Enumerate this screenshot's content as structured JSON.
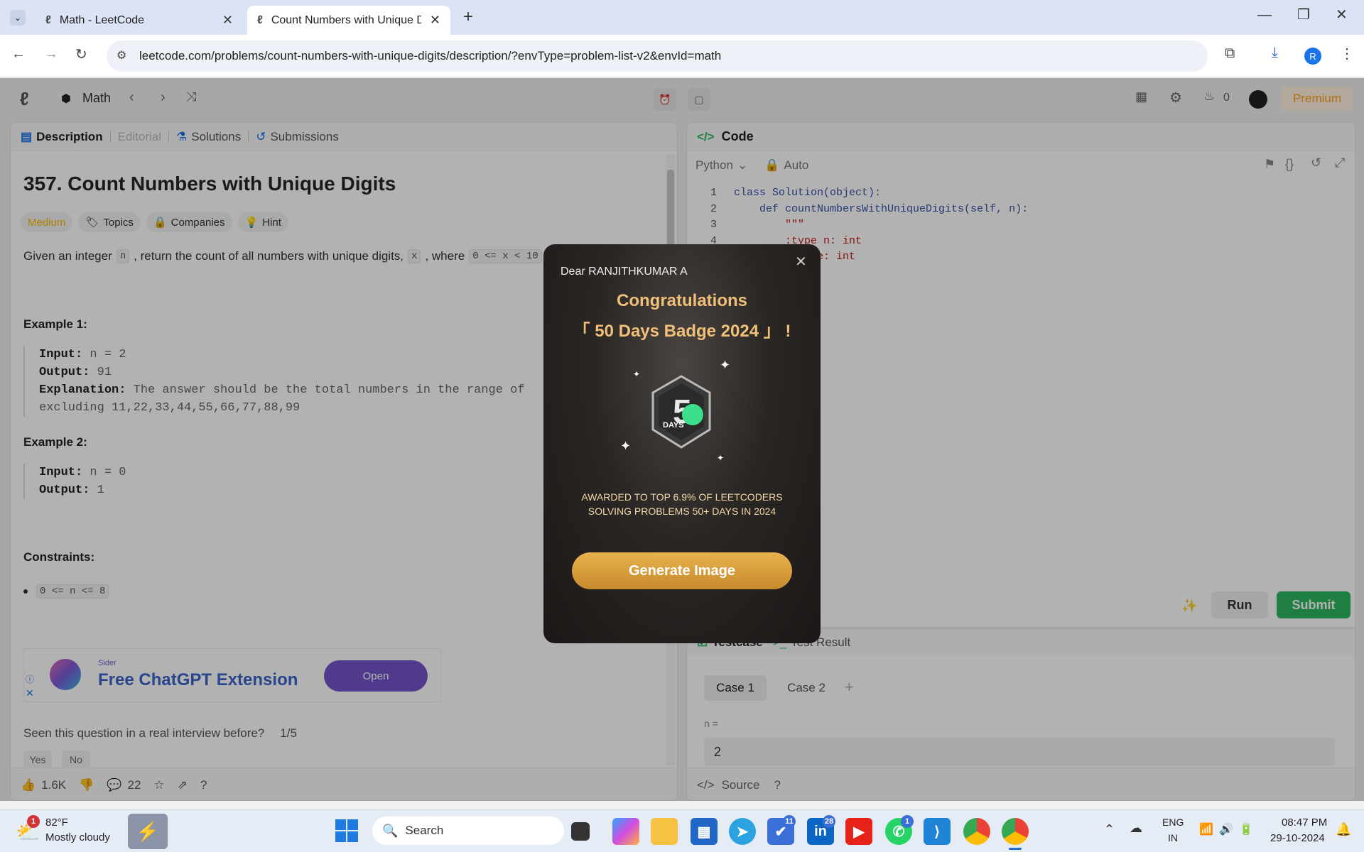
{
  "browser": {
    "tabs": [
      {
        "title": "Math - LeetCode"
      },
      {
        "title": "Count Numbers with Unique Di"
      }
    ],
    "url": "leetcode.com/problems/count-numbers-with-unique-digits/description/?envType=problem-list-v2&envId=math",
    "profile_initial": "R"
  },
  "nav": {
    "list_name": "Math",
    "streak": "0",
    "premium": "Premium"
  },
  "left": {
    "tabs": [
      "Description",
      "Editorial",
      "Solutions",
      "Submissions"
    ],
    "title": "357. Count Numbers with Unique Digits",
    "difficulty": "Medium",
    "chips": [
      "Topics",
      "Companies",
      "Hint"
    ],
    "statement_pre": "Given an integer",
    "statement_var_n": "n",
    "statement_mid": ", return the count of all numbers with unique digits,",
    "statement_var_x": "x",
    "statement_post": ", where",
    "statement_cond": "0 <= x < 10",
    "ex1_title": "Example 1:",
    "ex1_input_label": "Input:",
    "ex1_input": "n = 2",
    "ex1_output_label": "Output:",
    "ex1_output": "91",
    "ex1_expl_label": "Explanation:",
    "ex1_expl": "The answer should be the total numbers in the range of",
    "ex1_expl2": "excluding 11,22,33,44,55,66,77,88,99",
    "ex2_title": "Example 2:",
    "ex2_input_label": "Input:",
    "ex2_input": "n = 0",
    "ex2_output_label": "Output:",
    "ex2_output": "1",
    "constraints_title": "Constraints:",
    "constraint1": "0 <= n <= 8",
    "ad_brand": "Sider",
    "ad_title": "Free ChatGPT Extension",
    "ad_button": "Open",
    "interview_q": "Seen this question in a real interview before?",
    "interview_page": "1/5",
    "yes": "Yes",
    "no": "No",
    "likes": "1.6K",
    "comments": "22"
  },
  "right": {
    "code_title": "Code",
    "language": "Python",
    "mode": "Auto",
    "lines": [
      {
        "n": "1",
        "text": "class Solution(object):"
      },
      {
        "n": "2",
        "text": "    def countNumbersWithUniqueDigits(self, n):"
      },
      {
        "n": "3",
        "text": "        \"\"\""
      },
      {
        "n": "4",
        "text": "        :type n: int"
      },
      {
        "n": "5",
        "text": "        :rtype: int"
      }
    ],
    "run": "Run",
    "submit": "Submit",
    "testcase_tab": "Testcase",
    "result_tab": "Test Result",
    "case1": "Case 1",
    "case2": "Case 2",
    "var_label": "n =",
    "var_value": "2",
    "source": "Source"
  },
  "modal": {
    "greeting": "Dear RANJITHKUMAR A",
    "congrats": "Congratulations",
    "badge": "「 50 Days Badge 2024 」 !",
    "badge_days": "DAYS",
    "awarded1": "AWARDED TO TOP 6.9% OF LEETCODERS",
    "awarded2": "SOLVING PROBLEMS 50+ DAYS IN 2024",
    "button": "Generate Image"
  },
  "taskbar": {
    "weather_temp": "82°F",
    "weather_desc": "Mostly cloudy",
    "weather_badge": "1",
    "search": "Search",
    "lang1": "ENG",
    "lang2": "IN",
    "time": "08:47 PM",
    "date": "29-10-2024",
    "badge_todo": "11",
    "badge_linkedin": "28",
    "badge_whatsapp": "1"
  },
  "colors": {
    "medium": "#ffb800",
    "submit_green": "#2db55d",
    "gold": "#f0c07a",
    "premium": "#ffa116"
  }
}
